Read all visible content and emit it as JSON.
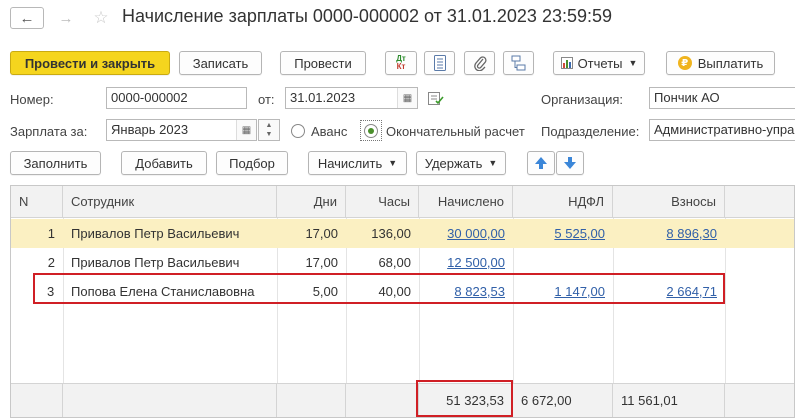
{
  "header": {
    "title": "Начисление зарплаты 0000-000002 от 31.01.2023 23:59:59",
    "back_glyph": "←",
    "forward_glyph": "→",
    "star_glyph": "☆"
  },
  "toolbar": {
    "post_close": "Провести и закрыть",
    "save": "Записать",
    "post": "Провести",
    "dt_kt_top": "Дт",
    "dt_kt_bottom": "Кт",
    "reports": "Отчеты",
    "pay": "Выплатить",
    "pay_icon": "₽"
  },
  "form": {
    "number_label": "Номер:",
    "number_value": "0000-000002",
    "date_label": "от:",
    "date_value": "31.01.2023",
    "org_label": "Организация:",
    "org_value": "Пончик АО",
    "salary_for_label": "Зарплата за:",
    "salary_for_value": "Январь 2023",
    "advance_label": "Аванс",
    "final_label": "Окончательный расчет",
    "dept_label": "Подразделение:",
    "dept_value": "Административно-упра"
  },
  "table_toolbar": {
    "fill": "Заполнить",
    "add": "Добавить",
    "pick": "Подбор",
    "accrue": "Начислить",
    "withhold": "Удержать"
  },
  "table": {
    "columns": [
      "N",
      "Сотрудник",
      "Дни",
      "Часы",
      "Начислено",
      "НДФЛ",
      "Взносы"
    ],
    "rows": [
      {
        "n": "1",
        "employee": "Привалов Петр Васильевич",
        "days": "17,00",
        "hours": "136,00",
        "accrued": "30 000,00",
        "ndfl": "5 525,00",
        "contrib": "8 896,30"
      },
      {
        "n": "2",
        "employee": "Привалов Петр Васильевич",
        "days": "17,00",
        "hours": "68,00",
        "accrued": "12 500,00",
        "ndfl": "",
        "contrib": ""
      },
      {
        "n": "3",
        "employee": "Попова Елена Станиславовна",
        "days": "5,00",
        "hours": "40,00",
        "accrued": "8 823,53",
        "ndfl": "1 147,00",
        "contrib": "2 664,71"
      }
    ],
    "totals": {
      "accrued": "51 323,53",
      "ndfl": "6 672,00",
      "contrib": "11 561,01"
    }
  },
  "colors": {
    "primary_button": "#f5d51e",
    "selected_row": "#fbf0c2",
    "link": "#3160a8",
    "highlight_box": "#d01f25"
  }
}
